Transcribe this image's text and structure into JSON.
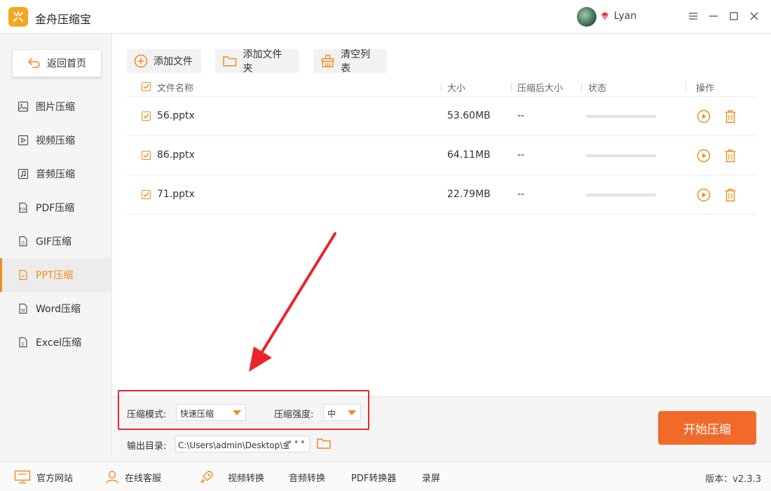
{
  "app": {
    "title": "金舟压缩宝",
    "username": "Lyan"
  },
  "sidebar": {
    "back_label": "返回首页",
    "items": [
      {
        "label": "图片压缩",
        "icon": "image-icon",
        "active": false
      },
      {
        "label": "视频压缩",
        "icon": "video-icon",
        "active": false
      },
      {
        "label": "音频压缩",
        "icon": "audio-icon",
        "active": false
      },
      {
        "label": "PDF压缩",
        "icon": "pdf-icon",
        "active": false
      },
      {
        "label": "GIF压缩",
        "icon": "gif-icon",
        "active": false
      },
      {
        "label": "PPT压缩",
        "icon": "ppt-icon",
        "active": true
      },
      {
        "label": "Word压缩",
        "icon": "word-icon",
        "active": false
      },
      {
        "label": "Excel压缩",
        "icon": "excel-icon",
        "active": false
      }
    ]
  },
  "toolbar": {
    "add_file": "添加文件",
    "add_folder": "添加文件夹",
    "clear_list": "清空列表"
  },
  "table": {
    "headers": {
      "name": "文件名称",
      "size": "大小",
      "compressed_size": "压缩后大小",
      "status": "状态",
      "actions": "操作"
    },
    "rows": [
      {
        "name": "56.pptx",
        "size": "53.60MB",
        "compressed": "--",
        "progress": 0
      },
      {
        "name": "86.pptx",
        "size": "64.11MB",
        "compressed": "--",
        "progress": 0
      },
      {
        "name": "71.pptx",
        "size": "22.79MB",
        "compressed": "--",
        "progress": 0
      }
    ]
  },
  "settings": {
    "mode_label": "压缩模式:",
    "mode_value": "快速压缩",
    "strength_label": "压缩强度:",
    "strength_value": "中",
    "output_label": "输出目录:",
    "output_path": "C:\\Users\\admin\\Desktop\\金舟压缩宝",
    "more_label": "•••",
    "start_label": "开始压缩"
  },
  "footer": {
    "website": "官方网站",
    "support": "在线客服",
    "links": [
      "视频转换",
      "音频转换",
      "PDF转换器",
      "录屏"
    ],
    "version": "版本：v2.3.3"
  },
  "colors": {
    "accent": "#f08a1d",
    "start_button": "#f26a2a",
    "highlight": "#e8262b"
  }
}
